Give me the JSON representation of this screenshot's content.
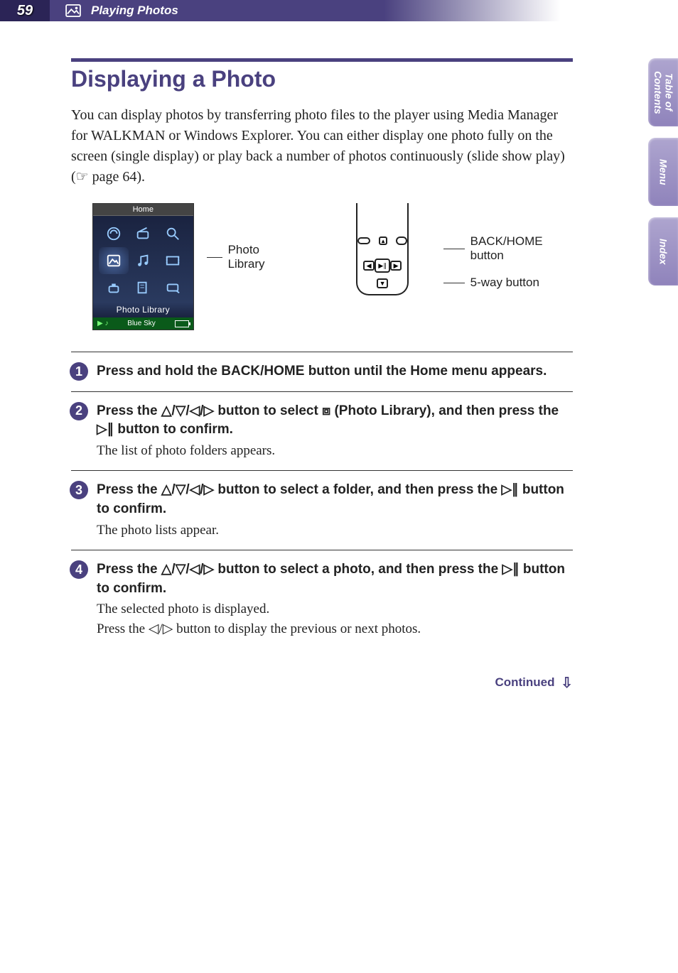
{
  "header": {
    "page_number": "59",
    "section_title": "Playing Photos"
  },
  "heading": "Displaying a Photo",
  "intro_text": "You can display photos by transferring photo files to the player using Media Manager for WALKMAN or Windows Explorer. You can either display one photo fully on the screen (single display) or play back a number of photos continuously (slide show play) (☞ page 64).",
  "figure": {
    "screen_top": "Home",
    "screen_label": "Photo Library",
    "screen_song": "Blue Sky",
    "callout_photo_library": "Photo Library",
    "callout_back_home": "BACK/HOME button",
    "callout_5way": "5-way button"
  },
  "steps": [
    {
      "n": "1",
      "title": "Press and hold the BACK/HOME button until the Home menu appears.",
      "desc": ""
    },
    {
      "n": "2",
      "title": "Press the △/▽/◁/▷ button to select ⧈ (Photo Library), and then press the ▷∥ button to confirm.",
      "desc": "The list of photo folders appears."
    },
    {
      "n": "3",
      "title": "Press the △/▽/◁/▷ button to select a folder, and then press the ▷∥ button to confirm.",
      "desc": "The photo lists appear."
    },
    {
      "n": "4",
      "title": "Press the △/▽/◁/▷ button to select a photo, and then press the ▷∥ button to confirm.",
      "desc": "The selected photo is displayed.\nPress the ◁/▷ button to display the previous or next photos."
    }
  ],
  "continued": "Continued",
  "side_tabs": {
    "toc": "Table of Contents",
    "menu": "Menu",
    "index": "Index"
  }
}
